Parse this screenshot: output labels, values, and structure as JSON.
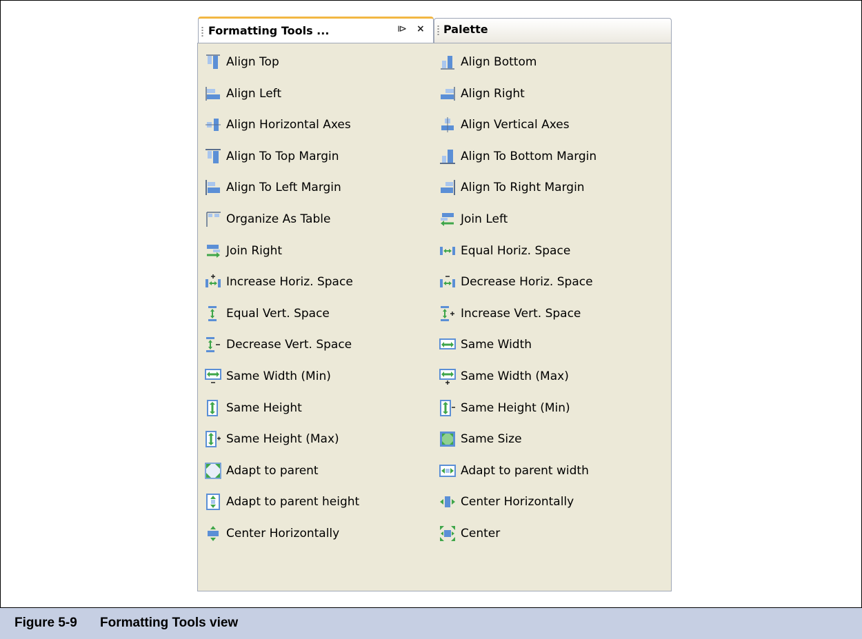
{
  "tabs": {
    "active_label": "Formatting Tools ...",
    "inactive_label": "Palette"
  },
  "controls": {
    "minimize_glyph": "⧐",
    "close_glyph": "×"
  },
  "tools": [
    {
      "label": "Align Top",
      "icon": "align-top-icon"
    },
    {
      "label": "Align Bottom",
      "icon": "align-bottom-icon"
    },
    {
      "label": "Align Left",
      "icon": "align-left-icon"
    },
    {
      "label": "Align Right",
      "icon": "align-right-icon"
    },
    {
      "label": "Align Horizontal Axes",
      "icon": "align-horizontal-axes-icon"
    },
    {
      "label": "Align Vertical Axes",
      "icon": "align-vertical-axes-icon"
    },
    {
      "label": "Align To Top Margin",
      "icon": "align-top-margin-icon"
    },
    {
      "label": "Align To Bottom Margin",
      "icon": "align-bottom-margin-icon"
    },
    {
      "label": "Align To Left Margin",
      "icon": "align-left-margin-icon"
    },
    {
      "label": "Align To Right Margin",
      "icon": "align-right-margin-icon"
    },
    {
      "label": "Organize As Table",
      "icon": "organize-table-icon"
    },
    {
      "label": "Join Left",
      "icon": "join-left-icon"
    },
    {
      "label": "Join Right",
      "icon": "join-right-icon"
    },
    {
      "label": "Equal Horiz. Space",
      "icon": "equal-horiz-space-icon"
    },
    {
      "label": "Increase Horiz. Space",
      "icon": "increase-horiz-space-icon"
    },
    {
      "label": "Decrease Horiz. Space",
      "icon": "decrease-horiz-space-icon"
    },
    {
      "label": "Equal Vert. Space",
      "icon": "equal-vert-space-icon"
    },
    {
      "label": "Increase Vert. Space",
      "icon": "increase-vert-space-icon"
    },
    {
      "label": "Decrease Vert. Space",
      "icon": "decrease-vert-space-icon"
    },
    {
      "label": "Same Width",
      "icon": "same-width-icon"
    },
    {
      "label": "Same Width (Min)",
      "icon": "same-width-min-icon"
    },
    {
      "label": "Same Width (Max)",
      "icon": "same-width-max-icon"
    },
    {
      "label": "Same Height",
      "icon": "same-height-icon"
    },
    {
      "label": "Same Height (Min)",
      "icon": "same-height-min-icon"
    },
    {
      "label": "Same Height (Max)",
      "icon": "same-height-max-icon"
    },
    {
      "label": "Same Size",
      "icon": "same-size-icon"
    },
    {
      "label": "Adapt to parent",
      "icon": "adapt-parent-icon"
    },
    {
      "label": "Adapt to parent width",
      "icon": "adapt-parent-width-icon"
    },
    {
      "label": "Adapt to parent height",
      "icon": "adapt-parent-height-icon"
    },
    {
      "label": "Center Horizontally",
      "icon": "center-horizontally-icon"
    },
    {
      "label": "Center Horizontally",
      "icon": "center-vertically-icon"
    },
    {
      "label": "Center",
      "icon": "center-icon"
    }
  ],
  "caption": {
    "number": "Figure 5-9",
    "title": "Formatting Tools view"
  },
  "colors": {
    "caption_bg": "#c6cfe3",
    "panel_bg": "#ece9d8",
    "active_tab_accent": "#f2b743",
    "icon_blue": "#5b8fd6",
    "icon_green": "#3fa64a"
  }
}
